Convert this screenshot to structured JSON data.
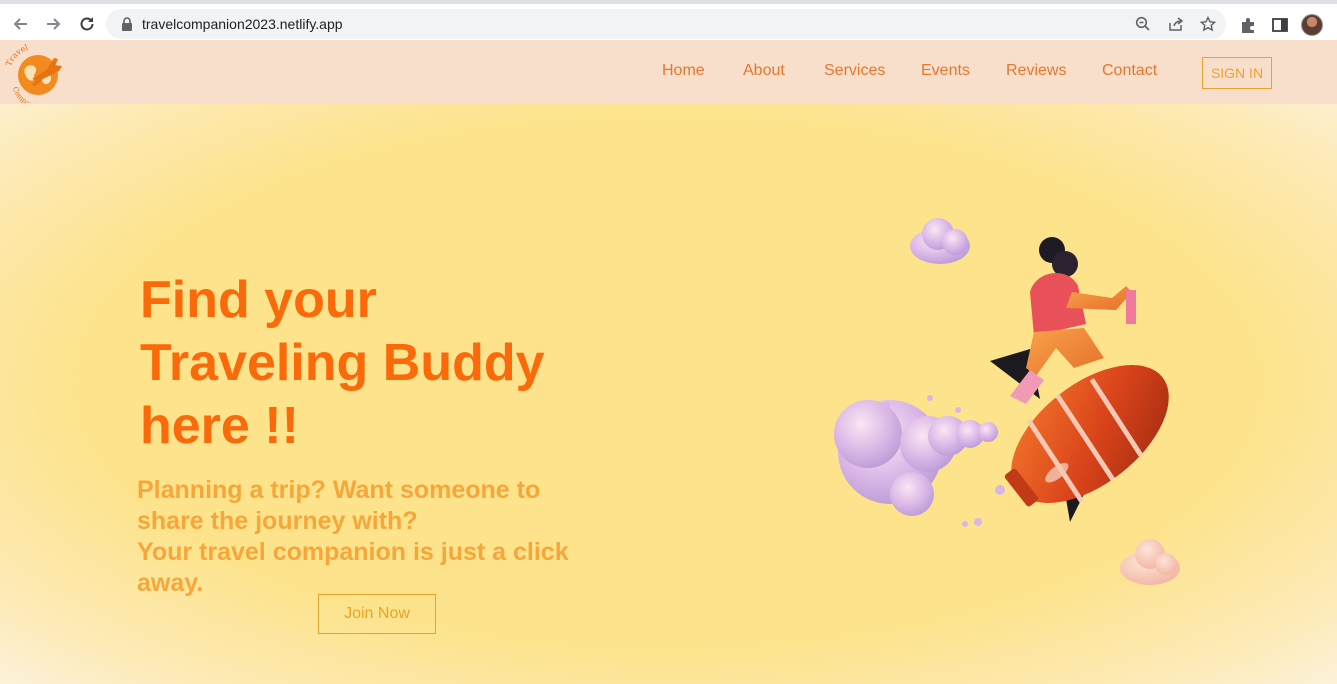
{
  "browser": {
    "url": "travelcompanion2023.netlify.app"
  },
  "header": {
    "logo_text_top": "Travel",
    "logo_text_bottom": "Companion",
    "nav": [
      "Home",
      "About",
      "Services",
      "Events",
      "Reviews",
      "Contact"
    ],
    "signin_label": "SIGN IN"
  },
  "hero": {
    "title_lines": [
      "Find your",
      "Traveling Buddy",
      "here !!"
    ],
    "subtitle_lines": [
      "Planning a trip? Want someone to",
      "share the journey with?",
      "Your travel companion is just a click",
      "away."
    ],
    "join_label": "Join Now"
  },
  "colors": {
    "accent": "#fb6a0a",
    "header_bg": "#f7dfcb",
    "hero_bg": "#fde49a",
    "subtitle": "#f7a63a"
  }
}
